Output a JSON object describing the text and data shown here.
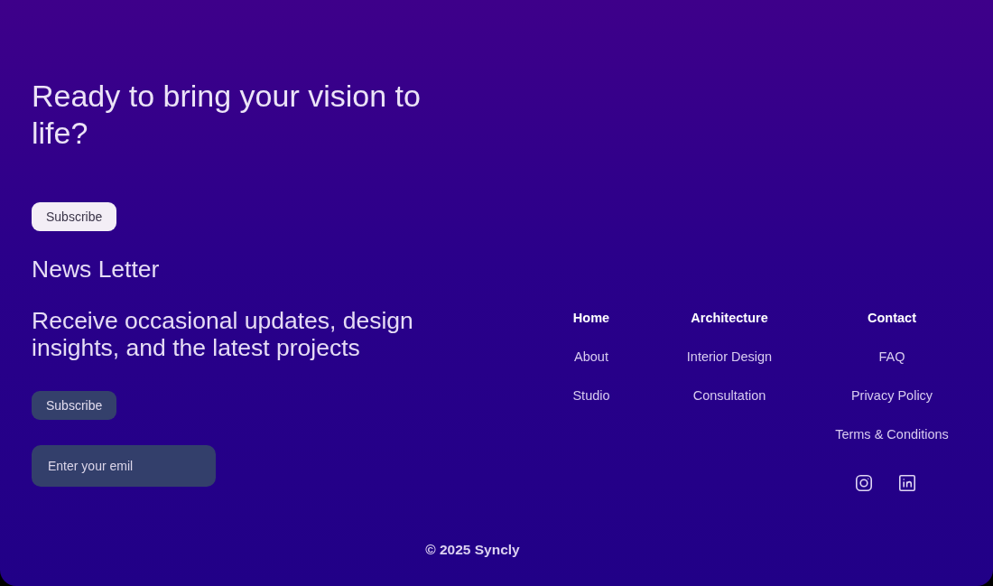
{
  "cta": {
    "heading": "Ready to bring your vision to life?",
    "button": "Subscribe"
  },
  "newsletter": {
    "title": "News Letter",
    "description": "Receive occasional updates, design insights, and the latest projects",
    "button": "Subscribe",
    "email_field": {
      "placeholder": "Enter your emil"
    }
  },
  "nav_columns": [
    {
      "heading": "Home",
      "links": [
        "About",
        "Studio"
      ]
    },
    {
      "heading": "Architecture",
      "links": [
        "Interior Design",
        "Consultation"
      ]
    },
    {
      "heading": "Contact",
      "links": [
        "FAQ",
        "Privacy Policy",
        "Terms & Conditions"
      ]
    }
  ],
  "social": [
    {
      "kind": "instagram"
    },
    {
      "kind": "linkedin"
    }
  ],
  "copyright": "© 2025 Syncly"
}
